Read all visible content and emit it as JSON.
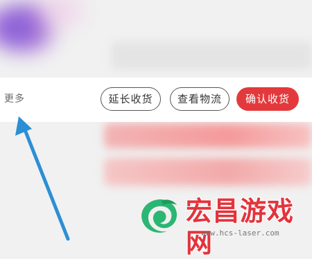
{
  "order_actions": {
    "more_label": "更多",
    "extend_receipt_label": "延长收货",
    "view_logistics_label": "查看物流",
    "confirm_receipt_label": "确认收货"
  },
  "watermark": {
    "brand_name": "宏昌游戏网",
    "url": "www.hcs-laser.com"
  },
  "colors": {
    "confirm_button": "#e4393c",
    "annotation_arrow": "#2b8fd6",
    "watermark_text": "#e3343c",
    "logo_green": "#2bb673"
  },
  "icons": [
    "annotation-arrow",
    "dragon-logo-icon"
  ]
}
